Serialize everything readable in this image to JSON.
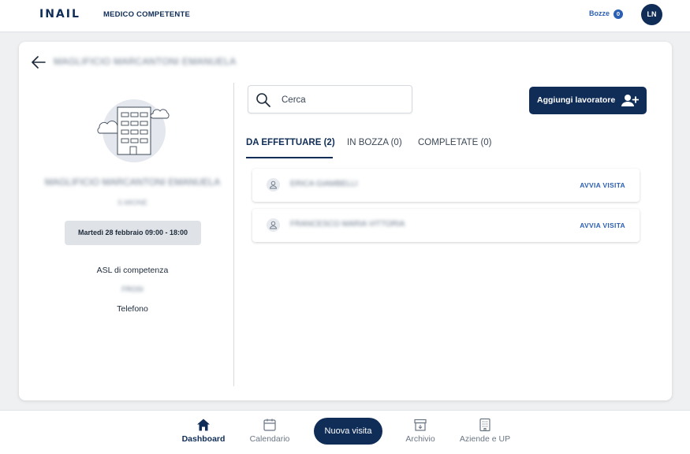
{
  "header": {
    "logo_text": "INAIL",
    "app_title": "MEDICO COMPETENTE",
    "drafts_label": "Bozze",
    "drafts_count": "0",
    "avatar_initials": "LN"
  },
  "company": {
    "heading": "MAGLIFICIO MARCANTONI EMANUELA",
    "name": "MAGLIFICIO MARCANTONI EMANUELA",
    "city": "S.MIONE",
    "schedule": "Martedì 28 febbraio  09:00 - 18:00",
    "asl_label": "ASL di competenza",
    "asl_value": "FROSI",
    "phone_label": "Telefono"
  },
  "search": {
    "placeholder": "Cerca"
  },
  "actions": {
    "add_worker": "Aggiungi lavoratore"
  },
  "tabs": [
    {
      "label": "DA EFFETTUARE  (2)",
      "active": true
    },
    {
      "label": "IN BOZZA (0)",
      "active": false
    },
    {
      "label": "COMPLETATE (0)",
      "active": false
    }
  ],
  "workers": [
    {
      "name": "ERICA GIAMBELLI",
      "action": "AVVIA VISITA"
    },
    {
      "name": "FRANCESCO MARIA VITTORIA",
      "action": "AVVIA VISITA"
    }
  ],
  "bottom_nav": {
    "dashboard": "Dashboard",
    "calendar": "Calendario",
    "new_visit": "Nuova visita",
    "archive": "Archivio",
    "companies": "Aziende e UP"
  },
  "colors": {
    "brand": "#0f2d57",
    "accent": "#2b5fb4"
  }
}
